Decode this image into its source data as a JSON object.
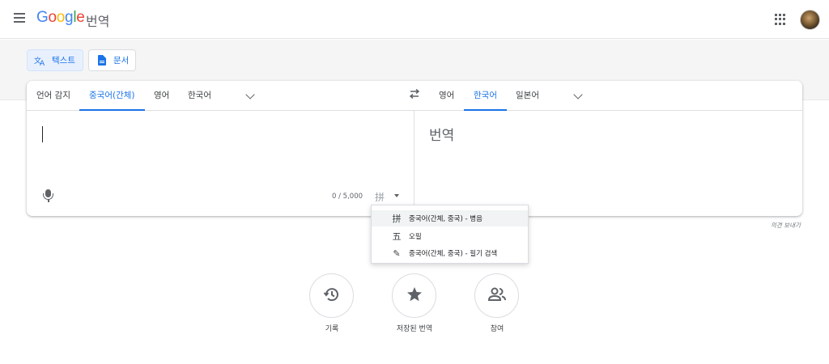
{
  "header": {
    "logo_letters": [
      "G",
      "o",
      "o",
      "g",
      "l",
      "e"
    ],
    "product": "번역"
  },
  "modes": {
    "text_label": "텍스트",
    "document_label": "문서"
  },
  "source_langs": [
    "언어 감지",
    "중국어(간체)",
    "영어",
    "한국어"
  ],
  "target_langs": [
    "영어",
    "한국어",
    "일본어"
  ],
  "source": {
    "char_count": "0 / 5,000",
    "ime_glyph": "拼"
  },
  "target": {
    "placeholder": "번역"
  },
  "feedback": "의견 보내기",
  "ime_menu": {
    "items": [
      {
        "glyph": "拼",
        "label": "중국어(간체, 중국) - 병음"
      },
      {
        "glyph": "五",
        "label": "오필"
      },
      {
        "glyph": "✎",
        "label": "중국어(간체, 중국) - 필기 검색"
      }
    ]
  },
  "bottom_actions": [
    {
      "label": "기록",
      "icon": "history-icon"
    },
    {
      "label": "저장된 번역",
      "icon": "star-icon"
    },
    {
      "label": "참여",
      "icon": "people-icon"
    }
  ],
  "colors": {
    "accent": "#1a73e8",
    "logo_blue": "#4285f4",
    "logo_red": "#ea4335",
    "logo_yellow": "#fbbc05",
    "logo_green": "#34a853"
  }
}
